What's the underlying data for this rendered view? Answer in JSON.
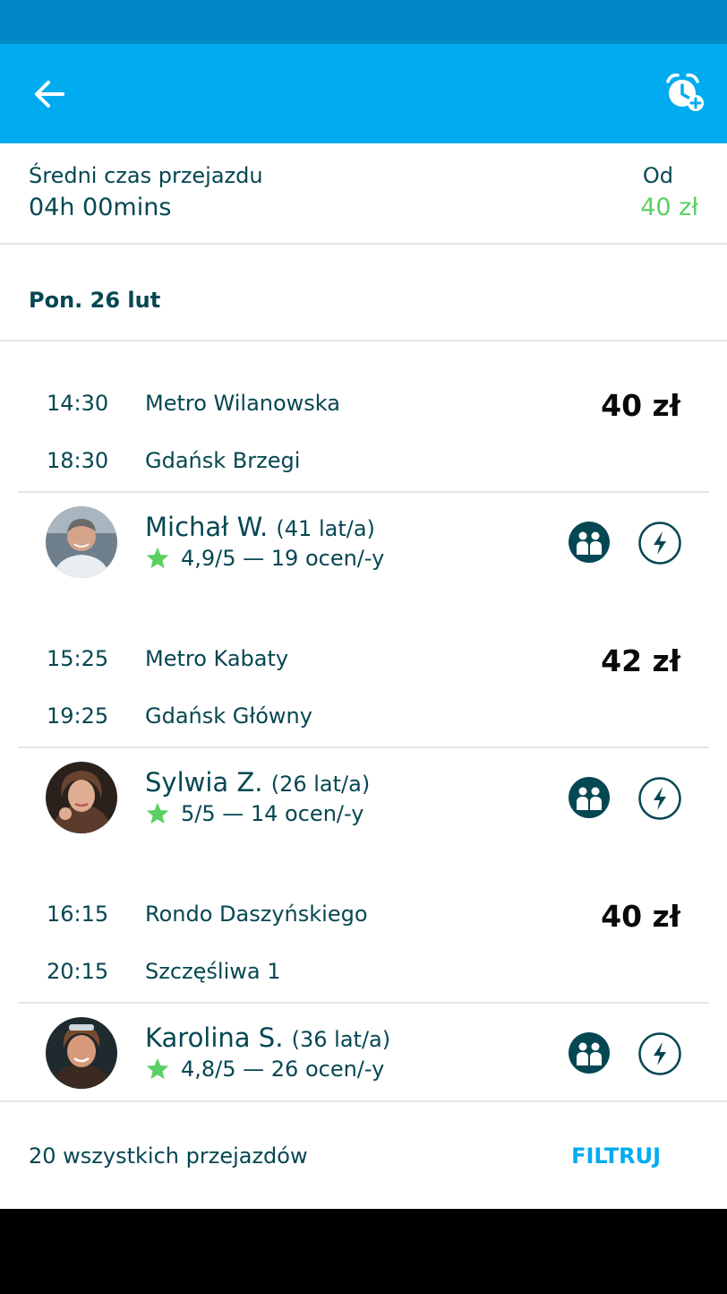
{
  "header": {
    "back_icon": "arrow-left-icon",
    "alarm_icon": "alarm-plus-icon",
    "bar_color": "#00acef"
  },
  "summary": {
    "avg_label": "Średni czas przejazdu",
    "avg_value": "04h 00mins",
    "from_label": "Od",
    "from_value": "40 zł",
    "accent_color": "#5ad062"
  },
  "date": "Pon. 26 lut",
  "trips": [
    {
      "dep_time": "14:30",
      "dep_place": "Metro Wilanowska",
      "arr_time": "18:30",
      "arr_place": "Gdańsk Brzegi",
      "price": "40 zł",
      "driver_name": "Michał W.",
      "driver_age": "(41 lat/a)",
      "rating": "4,9/5 — 19 ocen/-y"
    },
    {
      "dep_time": "15:25",
      "dep_place": "Metro Kabaty",
      "arr_time": "19:25",
      "arr_place": "Gdańsk Główny",
      "price": "42 zł",
      "driver_name": "Sylwia Z.",
      "driver_age": "(26 lat/a)",
      "rating": "5/5 — 14 ocen/-y"
    },
    {
      "dep_time": "16:15",
      "dep_place": "Rondo Daszyńskiego",
      "arr_time": "20:15",
      "arr_place": "Szczęśliwa 1",
      "price": "40 zł",
      "driver_name": "Karolina S.",
      "driver_age": "(36 lat/a)",
      "rating": "4,8/5 — 26 ocen/-y"
    }
  ],
  "footer": {
    "total": "20 wszystkich przejazdów",
    "filter": "FILTRUJ"
  }
}
